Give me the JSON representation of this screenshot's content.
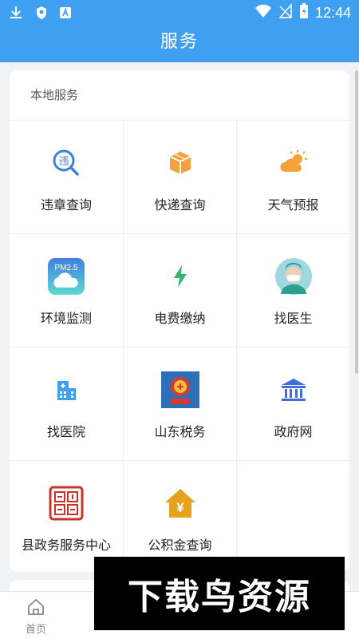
{
  "status_bar": {
    "time": "12:44",
    "left_icons": [
      "download-icon",
      "shield-icon",
      "app-a-icon"
    ],
    "right_icons": [
      "wifi-icon",
      "no-signal-icon",
      "battery-charging-icon"
    ]
  },
  "header": {
    "title": "服务"
  },
  "section": {
    "title": "本地服务",
    "items": [
      {
        "label": "违章查询",
        "icon": "violation-search-icon"
      },
      {
        "label": "快递查询",
        "icon": "package-icon"
      },
      {
        "label": "天气预报",
        "icon": "weather-icon"
      },
      {
        "label": "环境监测",
        "icon": "pm25-icon",
        "icon_text": "PM2.5"
      },
      {
        "label": "电费缴纳",
        "icon": "lightning-icon"
      },
      {
        "label": "找医生",
        "icon": "doctor-avatar-icon"
      },
      {
        "label": "找医院",
        "icon": "hospital-icon"
      },
      {
        "label": "山东税务",
        "icon": "tax-emblem-icon"
      },
      {
        "label": "政府网",
        "icon": "government-building-icon"
      },
      {
        "label": "县政务服务中心",
        "icon": "seal-stamp-icon"
      },
      {
        "label": "公积金查询",
        "icon": "housing-fund-icon",
        "icon_text": "¥"
      }
    ]
  },
  "bottom_nav": {
    "items": [
      {
        "label": "首页",
        "icon": "home-icon",
        "active": false
      },
      {
        "label": "",
        "icon": "tab-2-icon",
        "active": false
      },
      {
        "label": "",
        "icon": "tab-3-icon",
        "active": false
      },
      {
        "label": "",
        "icon": "tab-4-icon",
        "active": true
      },
      {
        "label": "",
        "icon": "tab-5-icon",
        "active": false
      }
    ]
  },
  "watermark": {
    "text": "下载鸟资源"
  },
  "colors": {
    "primary": "#3fa0f2",
    "orange": "#f5a03a",
    "green": "#2fb877",
    "red": "#d63a2e"
  }
}
